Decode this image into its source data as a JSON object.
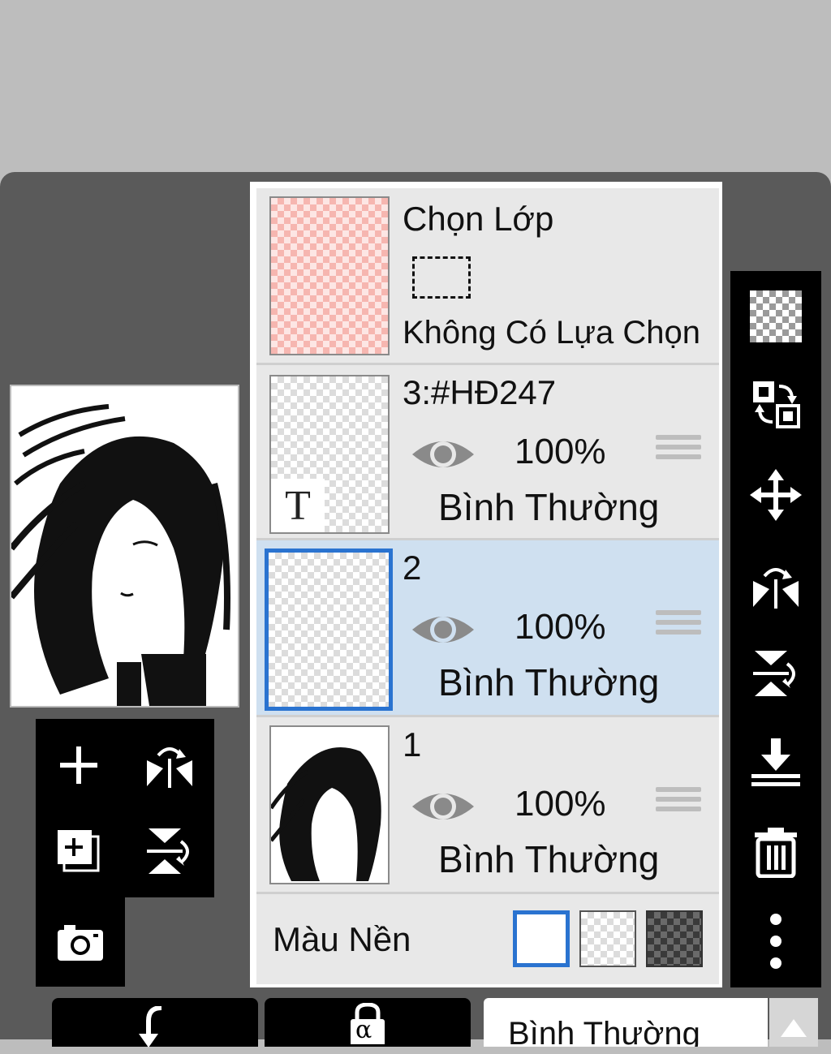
{
  "selection_row": {
    "title": "Chọn Lớp",
    "subtitle": "Không Có Lựa Chọn"
  },
  "layers": [
    {
      "name": "3:#HĐ247",
      "opacity": "100%",
      "blend": "Bình Thường",
      "thumb_text": "T",
      "selected": false
    },
    {
      "name": "2",
      "opacity": "100%",
      "blend": "Bình Thường",
      "selected": true
    },
    {
      "name": "1",
      "opacity": "100%",
      "blend": "Bình Thường",
      "selected": false
    }
  ],
  "background_row": {
    "label": "Màu Nền",
    "options": [
      "white",
      "transparent",
      "dark-checker"
    ],
    "selected": "white"
  },
  "bottom_bar": {
    "blend_mode_value": "Bình Thường",
    "alpha_lock_glyph": "α"
  },
  "colors": {
    "selection_blue": "#2a73d0",
    "selected_row": "#cfe0f0",
    "panel_bg": "#5a5a5a",
    "toolbar_bg": "#000000"
  }
}
